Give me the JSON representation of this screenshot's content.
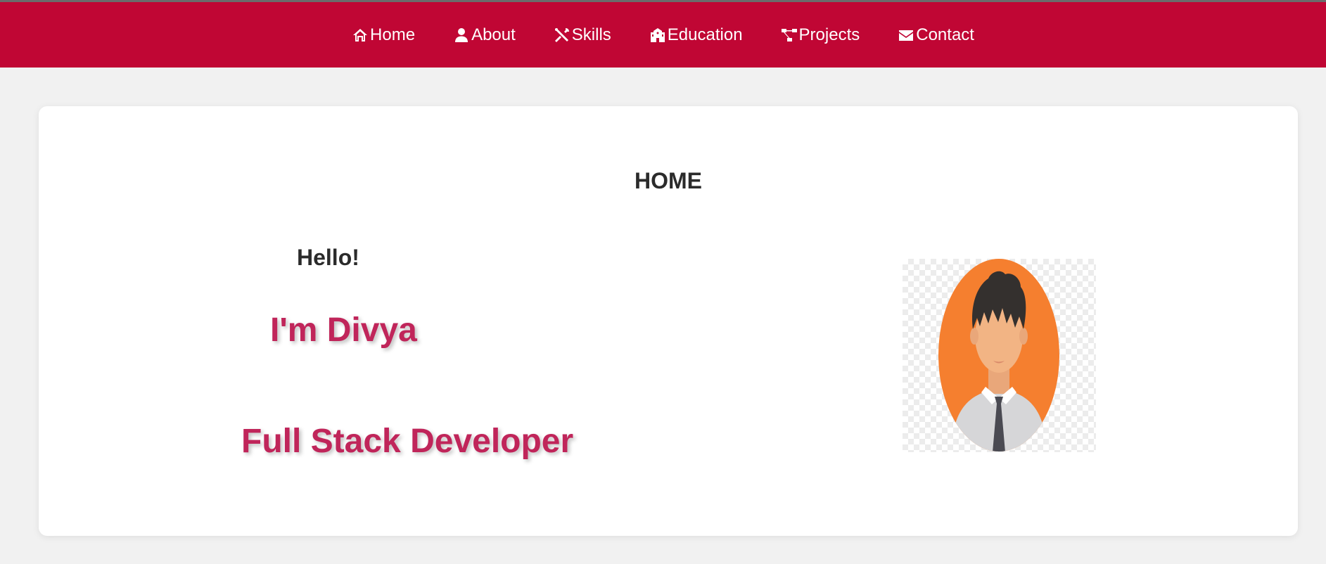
{
  "nav": {
    "items": [
      {
        "label": "Home",
        "icon": "home-icon"
      },
      {
        "label": "About",
        "icon": "user-icon"
      },
      {
        "label": "Skills",
        "icon": "tools-icon"
      },
      {
        "label": "Education",
        "icon": "school-icon"
      },
      {
        "label": "Projects",
        "icon": "project-diagram-icon"
      },
      {
        "label": "Contact",
        "icon": "envelope-icon"
      }
    ]
  },
  "home": {
    "title": "HOME",
    "greeting": "Hello!",
    "name": "I'm Divya",
    "role": "Full Stack Developer",
    "avatar_icon": "male-avatar-icon"
  },
  "colors": {
    "navbar": "#c00634",
    "accent": "#c0255a",
    "avatar_bg": "#f57f2f"
  }
}
